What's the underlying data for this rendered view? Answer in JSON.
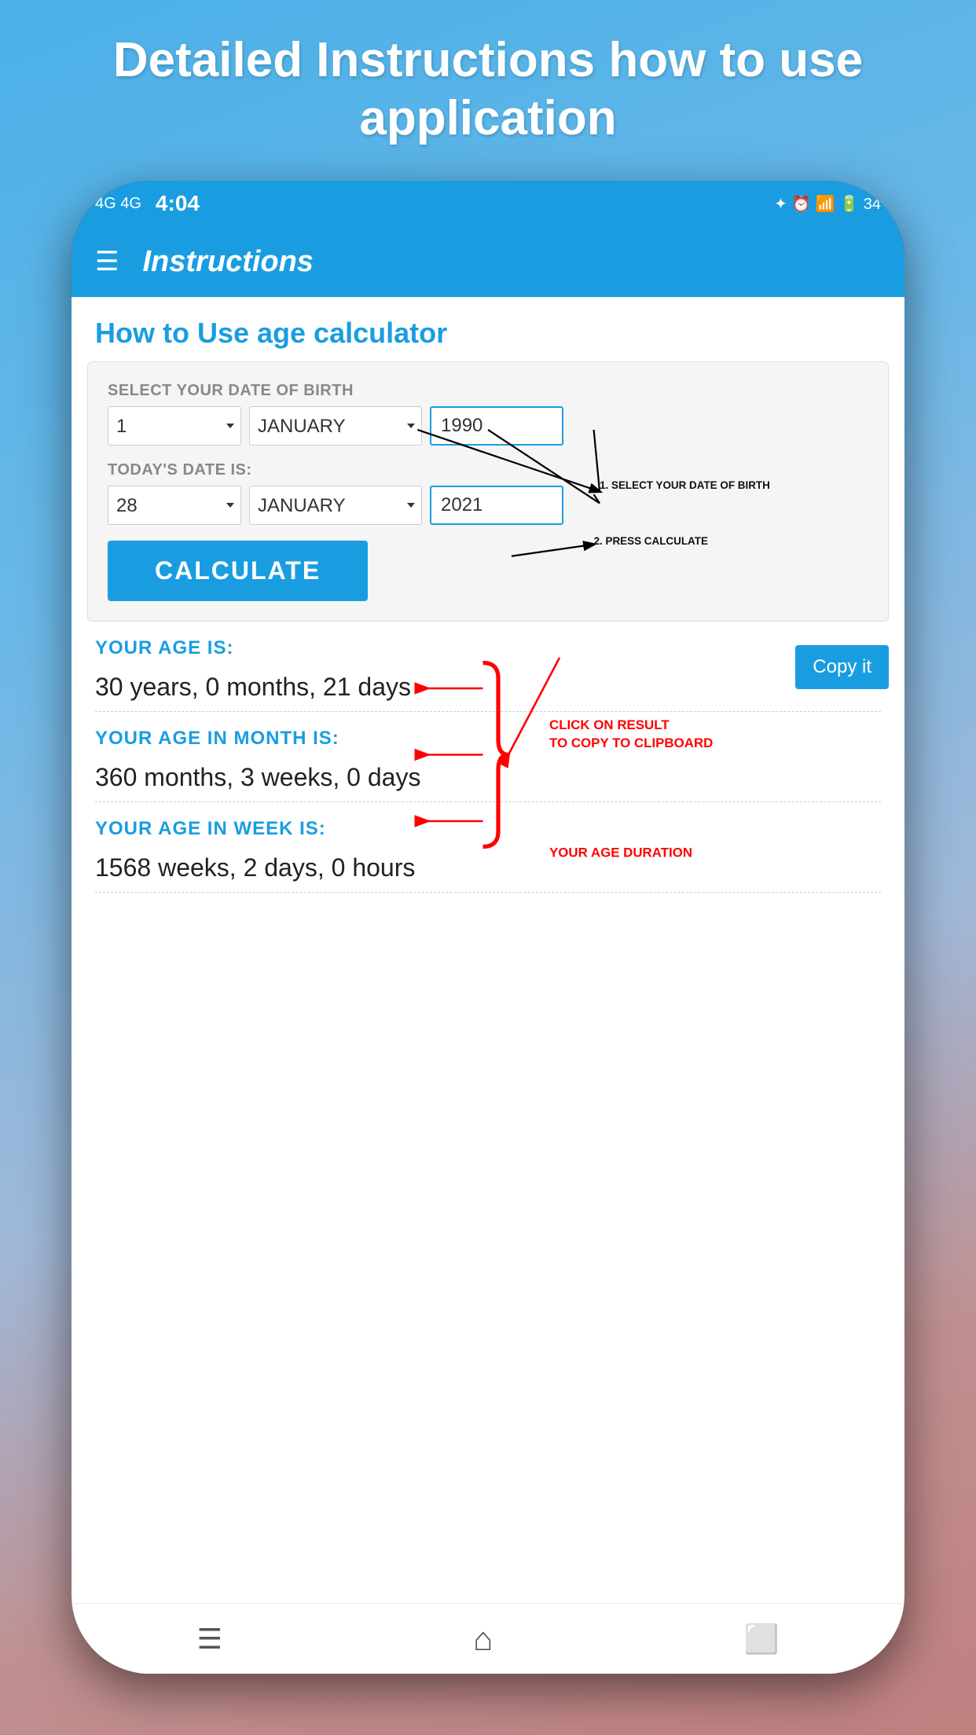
{
  "page": {
    "header": "Detailed Instructions how to use application",
    "background_gradient_start": "#4ab0e8",
    "background_gradient_end": "#c08080"
  },
  "status_bar": {
    "time": "4:04",
    "signal_left": "4G 4G",
    "icons_right": "⊕ ⏰ 📶 🔋"
  },
  "app_bar": {
    "title": "Instructions",
    "hamburger_label": "☰"
  },
  "screen": {
    "how_to_use_heading": "How to Use age calculator",
    "dob_label": "SELECT YOUR DATE OF BIRTH",
    "dob_day_value": "1",
    "dob_month_value": "JANUARY",
    "dob_year_value": "1990",
    "today_label": "TODAY'S DATE IS:",
    "today_day_value": "28",
    "today_month_value": "JANUARY",
    "today_year_value": "2021",
    "calculate_button": "CALCULATE",
    "instruction_1": "1. SELECT YOUR DATE OF BIRTH",
    "instruction_2": "2. PRESS CALCULATE",
    "your_age_label": "YOUR AGE IS:",
    "your_age_value": "30 years, 0 months, 21 days",
    "copy_button": "Copy it",
    "your_age_month_label": "YOUR AGE IN MONTH IS:",
    "your_age_month_value": "360 months, 3 weeks, 0 days",
    "your_age_week_label": "YOUR AGE IN WEEK IS:",
    "your_age_week_value": "1568 weeks, 2 days, 0 hours",
    "clipboard_annotation": "CLICK ON RESULT TO COPY TO CLIPBOARD",
    "age_duration_annotation": "YOUR AGE DURATION"
  },
  "bottom_nav": {
    "menu_icon": "☰",
    "home_icon": "⌂",
    "back_icon": "⬜"
  }
}
